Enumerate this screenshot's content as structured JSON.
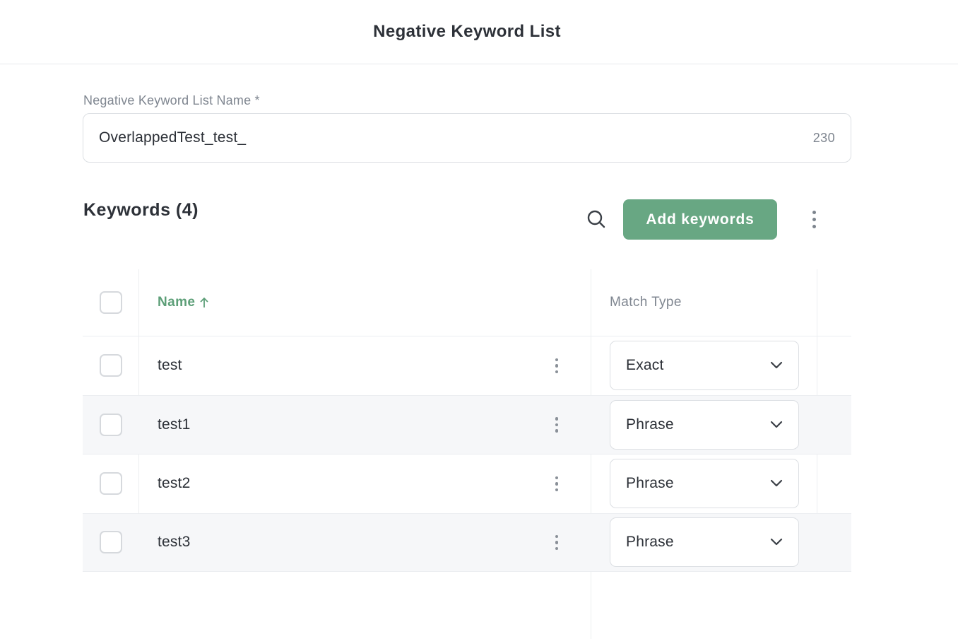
{
  "header": {
    "title": "Negative Keyword List"
  },
  "form": {
    "name_label": "Negative Keyword List Name *",
    "name_value": "OverlappedTest_test_",
    "char_count": "230"
  },
  "keywords": {
    "title": "Keywords (4)",
    "add_label": "Add keywords",
    "icons": {
      "search": "search-icon",
      "more": "more-vertical-icon"
    }
  },
  "table": {
    "columns": {
      "name": "Name",
      "name_sort": "ascending",
      "match_type": "Match Type"
    },
    "rows": [
      {
        "name": "test",
        "match_type": "Exact"
      },
      {
        "name": "test1",
        "match_type": "Phrase"
      },
      {
        "name": "test2",
        "match_type": "Phrase"
      },
      {
        "name": "test3",
        "match_type": "Phrase"
      }
    ]
  },
  "colors": {
    "accent": "#68a783",
    "accent_text": "#5d9f78",
    "row_alt": "#f6f7f9"
  }
}
